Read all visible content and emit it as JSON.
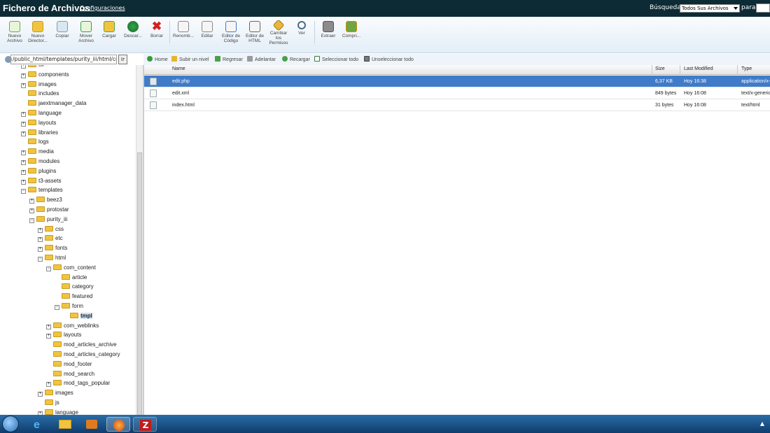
{
  "topbar": {
    "title": "Fichero de Archivos",
    "config_link": "Configuraciones",
    "search_label": "Búsqueda",
    "search_scope": "Todos Sus Archivos",
    "para_label": "para"
  },
  "toolbar": {
    "buttons": [
      {
        "l1": "Nuevo",
        "l2": "Archivo",
        "l3": "",
        "l4": ""
      },
      {
        "l1": "Nuevo",
        "l2": "Director...",
        "l3": "",
        "l4": ""
      },
      {
        "l1": "Copiar",
        "l2": "",
        "l3": "",
        "l4": ""
      },
      {
        "l1": "Mover",
        "l2": "Archivo",
        "l3": "",
        "l4": ""
      },
      {
        "l1": "Cargar",
        "l2": "",
        "l3": "",
        "l4": ""
      },
      {
        "l1": "Descar...",
        "l2": "",
        "l3": "",
        "l4": ""
      },
      {
        "l1": "Borrar",
        "l2": "",
        "l3": "",
        "l4": ""
      },
      {
        "l1": "Renomb...",
        "l2": "",
        "l3": "",
        "l4": ""
      },
      {
        "l1": "Editar",
        "l2": "",
        "l3": "",
        "l4": ""
      },
      {
        "l1": "Editor de",
        "l2": "Código",
        "l3": "",
        "l4": ""
      },
      {
        "l1": "Editor de",
        "l2": "HTML",
        "l3": "",
        "l4": ""
      },
      {
        "l1": "Cambiar",
        "l2": "los",
        "l3": "Permisos",
        "l4": ""
      },
      {
        "l1": "Ver",
        "l2": "",
        "l3": "",
        "l4": ""
      },
      {
        "l1": "Extraer",
        "l2": "",
        "l3": "",
        "l4": ""
      },
      {
        "l1": "Compri...",
        "l2": "",
        "l3": "",
        "l4": ""
      }
    ]
  },
  "pathbar": {
    "path": "/public_html/templates/purity_iii/html/cor",
    "go_label": "Ir"
  },
  "actionbar": {
    "home": "Home",
    "up": "Subir un nivel",
    "back": "Regresar",
    "forward": "Adelantar",
    "reload": "Recargar",
    "select_all": "Seleccionar todo",
    "unselect_all": "Unseleccionar todo"
  },
  "tree": {
    "nodes": [
      {
        "label": "cli",
        "exp": "+"
      },
      {
        "label": "components",
        "exp": "+"
      },
      {
        "label": "images",
        "exp": "+"
      },
      {
        "label": "includes",
        "exp": ""
      },
      {
        "label": "jaextmanager_data",
        "exp": ""
      },
      {
        "label": "language",
        "exp": "+"
      },
      {
        "label": "layouts",
        "exp": "+"
      },
      {
        "label": "libraries",
        "exp": "+"
      },
      {
        "label": "logs",
        "exp": ""
      },
      {
        "label": "media",
        "exp": "+"
      },
      {
        "label": "modules",
        "exp": "+"
      },
      {
        "label": "plugins",
        "exp": "+"
      },
      {
        "label": "t3-assets",
        "exp": "+"
      },
      {
        "label": "templates",
        "exp": "−"
      },
      {
        "label": "beez3",
        "exp": "+"
      },
      {
        "label": "protostar",
        "exp": "+"
      },
      {
        "label": "purity_iii",
        "exp": "−"
      },
      {
        "label": "css",
        "exp": "+"
      },
      {
        "label": "etc",
        "exp": "+"
      },
      {
        "label": "fonts",
        "exp": "+"
      },
      {
        "label": "html",
        "exp": "−"
      },
      {
        "label": "com_content",
        "exp": "−"
      },
      {
        "label": "article",
        "exp": ""
      },
      {
        "label": "category",
        "exp": ""
      },
      {
        "label": "featured",
        "exp": ""
      },
      {
        "label": "form",
        "exp": "−"
      },
      {
        "label": "tmpl",
        "exp": ""
      },
      {
        "label": "com_weblinks",
        "exp": "+"
      },
      {
        "label": "layouts",
        "exp": "+"
      },
      {
        "label": "mod_articles_archive",
        "exp": ""
      },
      {
        "label": "mod_articles_category",
        "exp": ""
      },
      {
        "label": "mod_footer",
        "exp": ""
      },
      {
        "label": "mod_search",
        "exp": ""
      },
      {
        "label": "mod_tags_popular",
        "exp": "+"
      },
      {
        "label": "images",
        "exp": "+"
      },
      {
        "label": "js",
        "exp": ""
      },
      {
        "label": "language",
        "exp": "+"
      }
    ]
  },
  "grid": {
    "headers": {
      "name": "Name",
      "size": "Size",
      "modified": "Last Modified",
      "type": "Type"
    },
    "rows": [
      {
        "name": "edit.php",
        "size": "6,37 KB",
        "modified": "Hoy 16:38",
        "type": "application/x-"
      },
      {
        "name": "edit.xml",
        "size": "849 bytes",
        "modified": "Hoy 16:08",
        "type": "text/x-generic"
      },
      {
        "name": "index.html",
        "size": "31 bytes",
        "modified": "Hoy 16:08",
        "type": "text/html"
      }
    ]
  }
}
